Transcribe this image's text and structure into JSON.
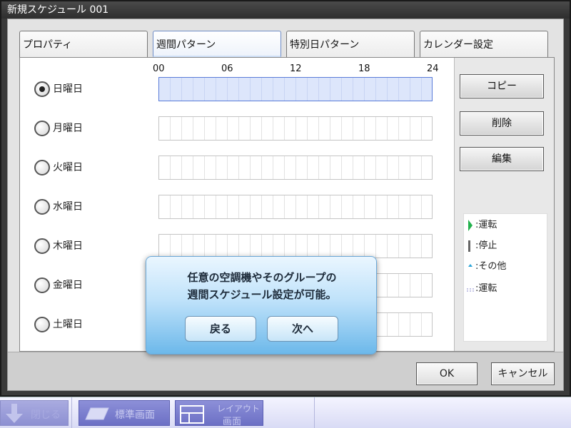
{
  "window": {
    "title": "新規スケジュール 001"
  },
  "tabs": [
    {
      "label": "プロパティ",
      "active": false
    },
    {
      "label": "週間パターン",
      "active": true
    },
    {
      "label": "特別日パターン",
      "active": false
    },
    {
      "label": "カレンダー設定",
      "active": false
    }
  ],
  "timeline": {
    "hour_labels": [
      "00",
      "06",
      "12",
      "18",
      "24"
    ]
  },
  "days": [
    {
      "label": "日曜日",
      "selected": true
    },
    {
      "label": "月曜日",
      "selected": false
    },
    {
      "label": "火曜日",
      "selected": false
    },
    {
      "label": "水曜日",
      "selected": false
    },
    {
      "label": "木曜日",
      "selected": false
    },
    {
      "label": "金曜日",
      "selected": false
    },
    {
      "label": "土曜日",
      "selected": false
    }
  ],
  "side_buttons": {
    "copy": "コピー",
    "delete": "削除",
    "edit": "編集"
  },
  "legend": [
    {
      "label": ":運転",
      "symbol": "green-triangle-icon"
    },
    {
      "label": ":停止",
      "symbol": "gray-bar-icon"
    },
    {
      "label": ":その他",
      "symbol": "blue-dot-icon"
    },
    {
      "label": ":運転",
      "symbol": "dashed-line-icon"
    }
  ],
  "dialog_buttons": {
    "ok": "OK",
    "cancel": "キャンセル"
  },
  "tooltip": {
    "line1": "任意の空調機やそのグループの",
    "line2": "週間スケジュール設定が可能。",
    "back": "戻る",
    "next": "次へ"
  },
  "taskbar": {
    "close": "閉じる",
    "standard": "標準画面",
    "layout_line1": "レイアウト",
    "layout_line2": "画面"
  },
  "colors": {
    "selected_fill": "#dde6fb",
    "selected_border": "#5a7bd8",
    "running_green": "#22b14c",
    "stop_gray": "#666666",
    "tooltip_blue": "#6cb8ea"
  }
}
